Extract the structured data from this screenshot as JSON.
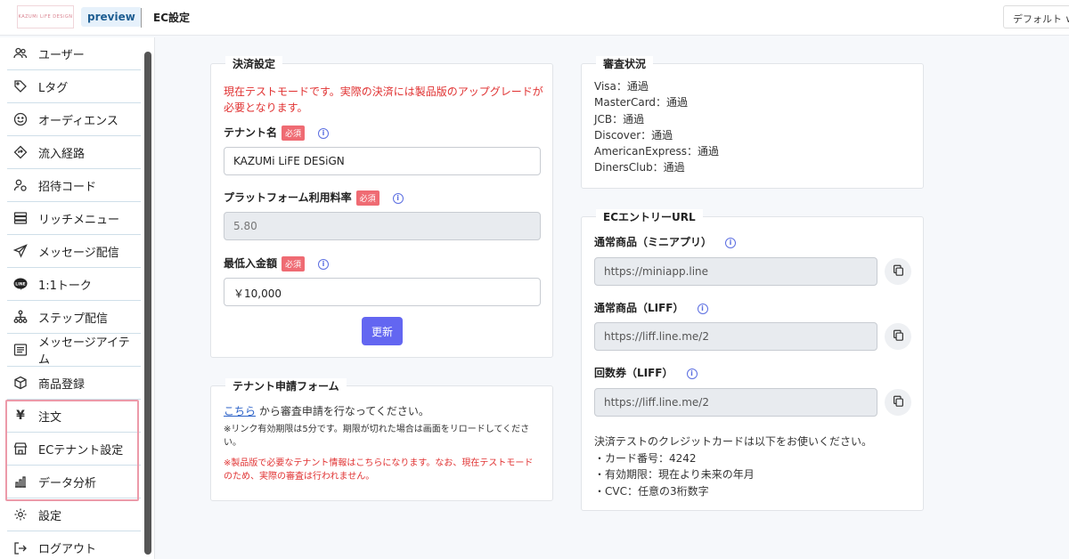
{
  "header": {
    "logo_text": "KAZUMi LiFE DESiGN",
    "preview_label": "preview",
    "title": "EC設定",
    "dropdown_value": "デフォルト"
  },
  "sidebar": {
    "items": [
      {
        "label": "ユーザー",
        "icon": "users-icon"
      },
      {
        "label": "Lタグ",
        "icon": "tag-icon"
      },
      {
        "label": "オーディエンス",
        "icon": "smile-icon"
      },
      {
        "label": "流入経路",
        "icon": "route-icon"
      },
      {
        "label": "招待コード",
        "icon": "user-invite-icon"
      },
      {
        "label": "リッチメニュー",
        "icon": "menu-icon"
      },
      {
        "label": "メッセージ配信",
        "icon": "send-icon"
      },
      {
        "label": "1:1トーク",
        "icon": "line-icon"
      },
      {
        "label": "ステップ配信",
        "icon": "hierarchy-icon"
      },
      {
        "label": "メッセージアイテム",
        "icon": "list-icon"
      },
      {
        "label": "商品登録",
        "icon": "box-icon"
      },
      {
        "label": "注文",
        "icon": "yen-icon"
      },
      {
        "label": "ECテナント設定",
        "icon": "store-icon"
      },
      {
        "label": "データ分析",
        "icon": "chart-icon"
      },
      {
        "label": "設定",
        "icon": "gear-icon"
      },
      {
        "label": "ログアウト",
        "icon": "logout-icon"
      }
    ]
  },
  "payment": {
    "title": "決済設定",
    "warning": "現在テストモードです。実際の決済には製品版のアップグレードが必要となります。",
    "required_badge": "必須",
    "tenant_label": "テナント名",
    "tenant_value": "KAZUMi LiFE DESiGN",
    "platform_label": "プラットフォーム利用料率",
    "platform_value": "5.80",
    "min_label": "最低入金額",
    "min_value": "￥10,000",
    "update_button": "更新"
  },
  "application": {
    "title": "テナント申請フォーム",
    "link_text": "こちら",
    "link_suffix": " から審査申請を行なってください。",
    "note1": "※リンク有効期限は5分です。期限が切れた場合は画面をリロードしてください。",
    "note2": "※製品版で必要なテナント情報はこちらになります。なお、現在テストモードのため、実際の審査は行われません。"
  },
  "review": {
    "title": "審査状況",
    "lines": [
      "Visa：通過",
      "MasterCard：通過",
      "JCB：通過",
      "Discover：通過",
      "AmericanExpress：通過",
      "DinersClub：通過"
    ]
  },
  "entry": {
    "title": "ECエントリーURL",
    "fields": [
      {
        "label": "通常商品（ミニアプリ）",
        "value": "https://miniapp.line"
      },
      {
        "label": "通常商品（LIFF）",
        "value": "https://liff.line.me/2"
      },
      {
        "label": "回数券（LIFF）",
        "value": "https://liff.line.me/2"
      }
    ],
    "test_intro": "決済テストのクレジットカードは以下をお使いください。",
    "test_lines": [
      "・カード番号：4242",
      "・有効期限：現在より未来の年月",
      "・CVC：任意の3桁数字"
    ]
  },
  "colors": {
    "accent": "#6366f1",
    "warning": "#e03131",
    "badge": "#ef6b73",
    "highlight_border": "#ec9aa9"
  }
}
